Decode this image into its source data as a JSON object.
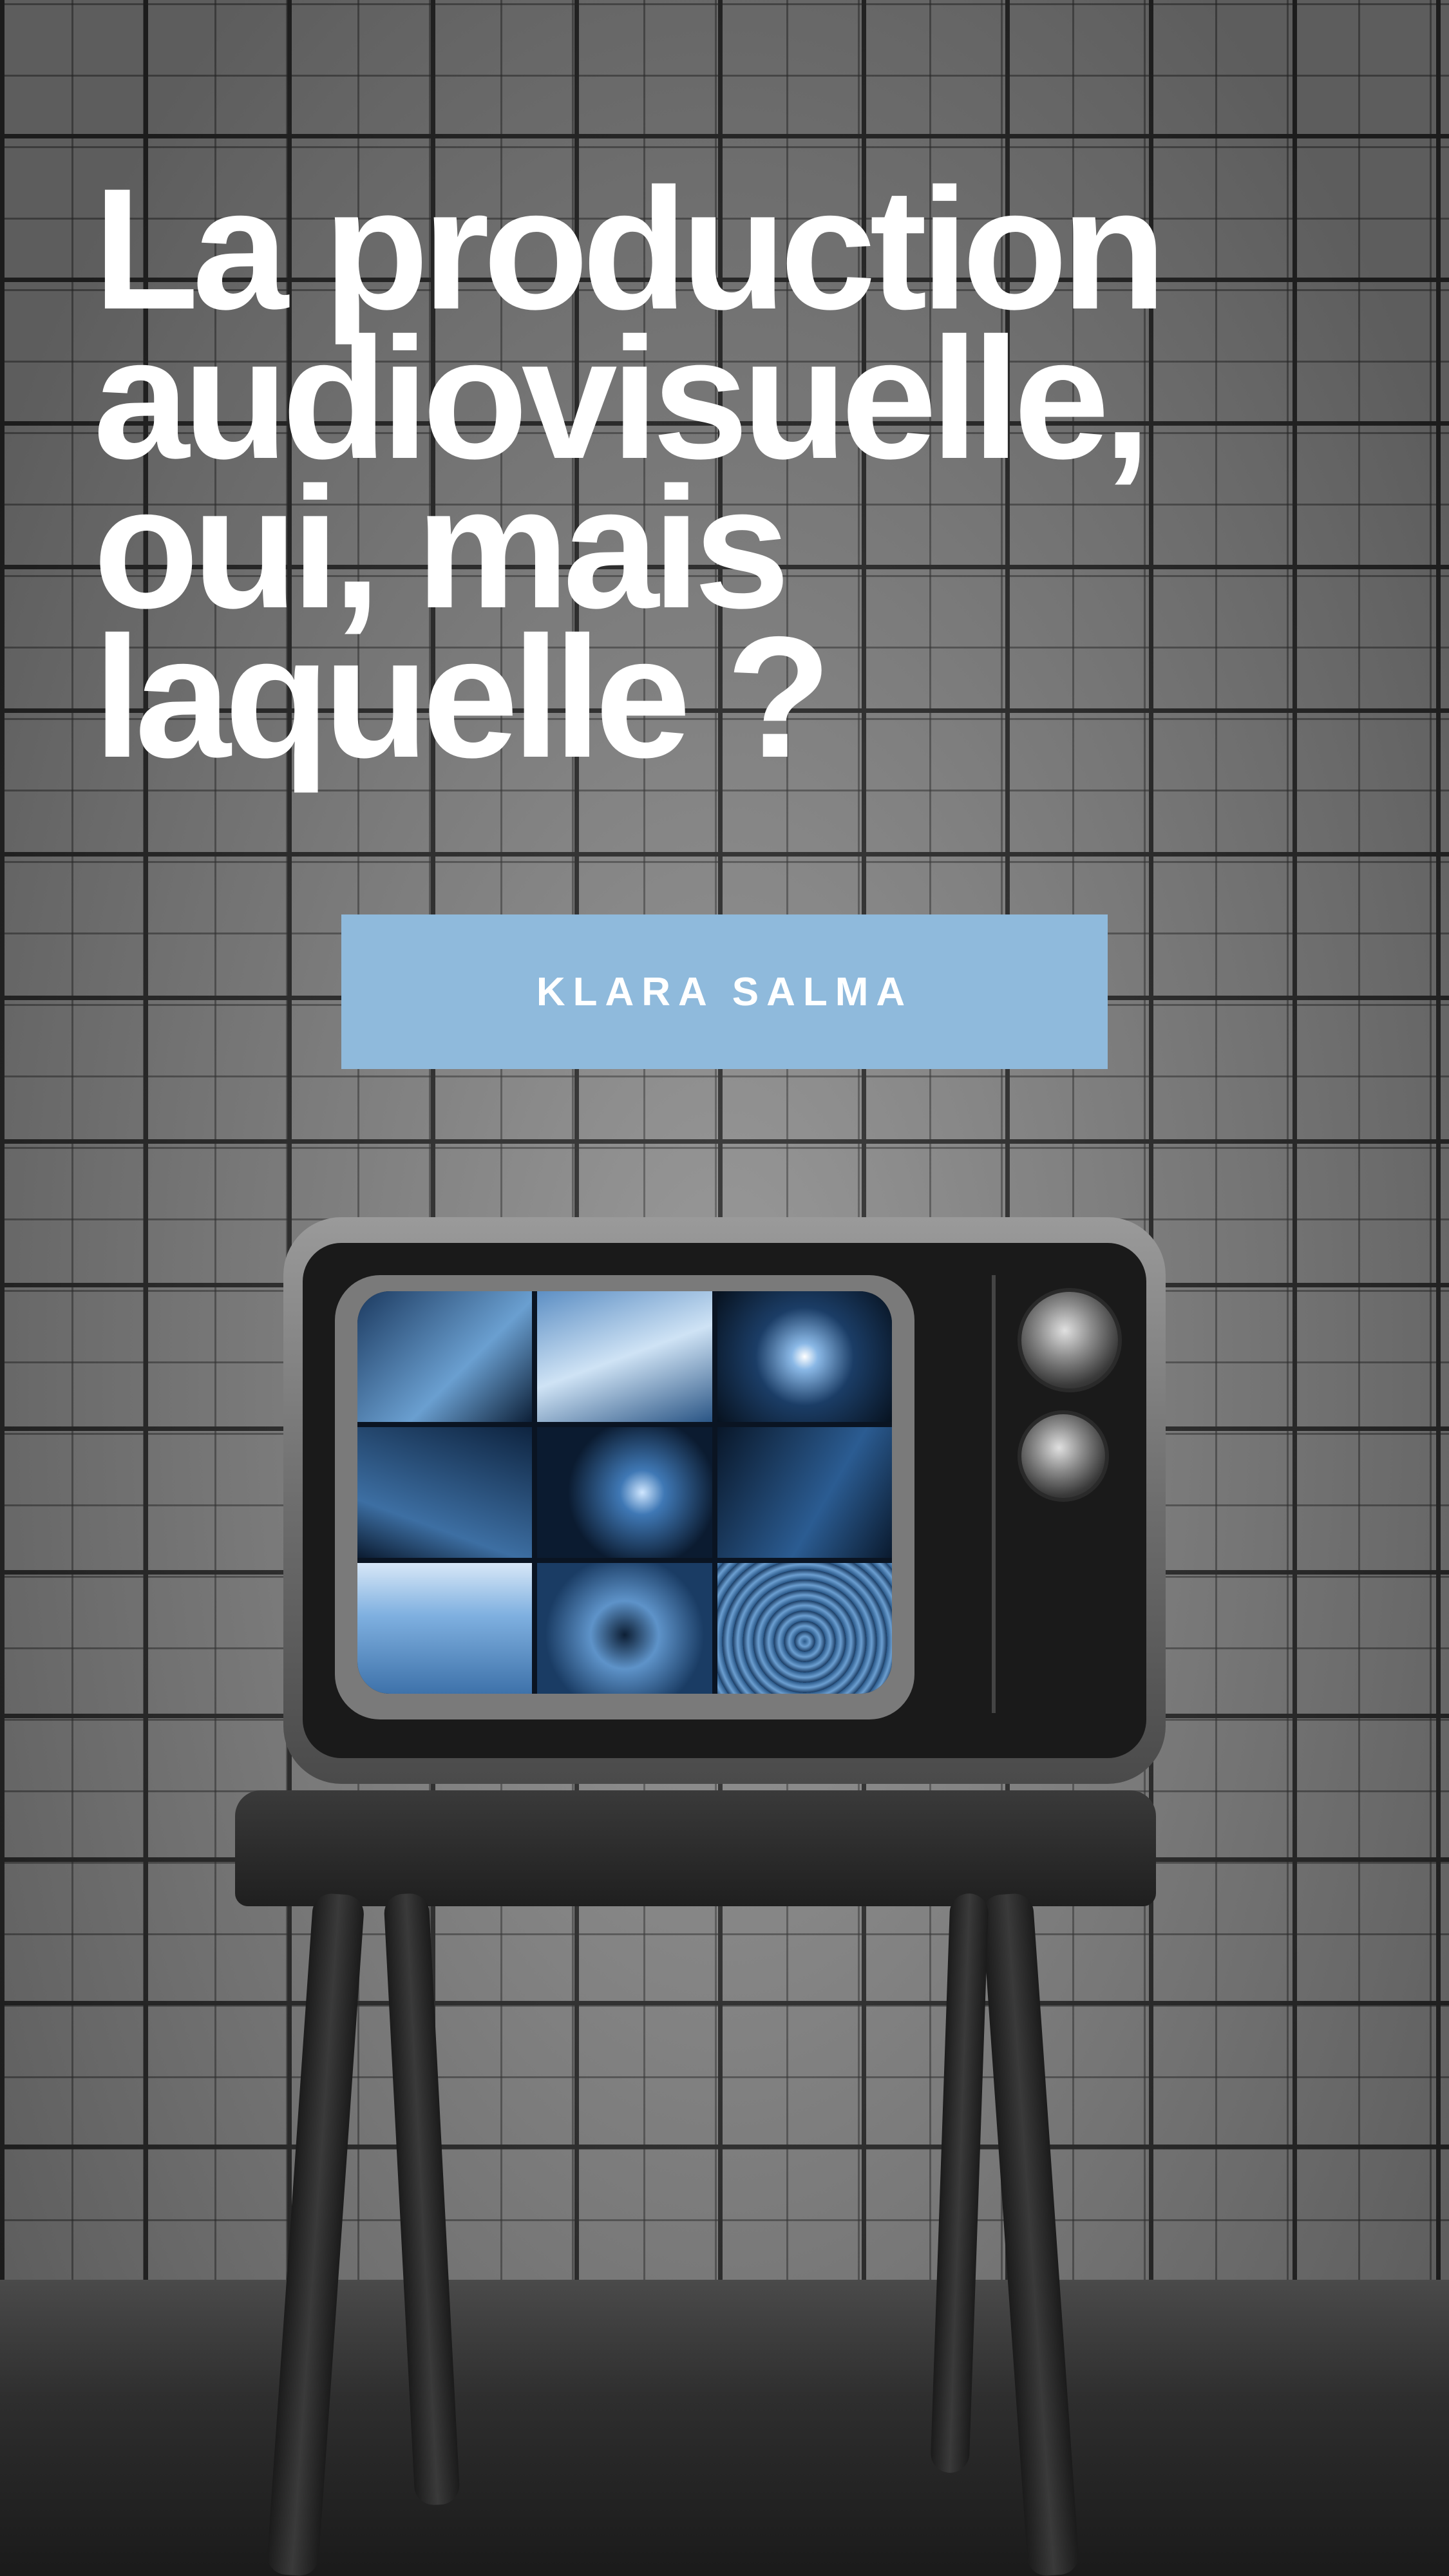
{
  "poster": {
    "title_lines": [
      "La production",
      "audiovisuelle,",
      "oui, mais",
      "laquelle ?"
    ],
    "author": "KLARA SALMA"
  },
  "colors": {
    "button_background": "#8fbadc",
    "title_text": "#ffffff",
    "screen_tint": "#5d8fc4"
  },
  "icons": [
    "tv-knob-icon",
    "tv-knob-icon"
  ]
}
